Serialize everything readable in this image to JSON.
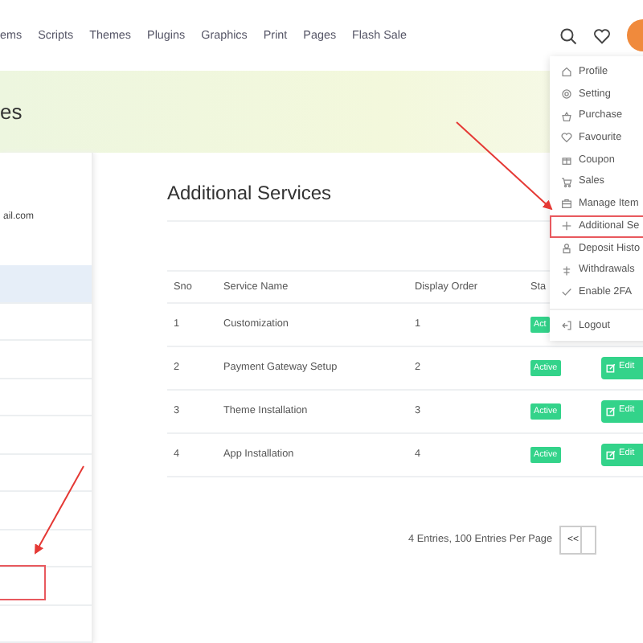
{
  "nav": {
    "items": [
      "ems",
      "Scripts",
      "Themes",
      "Plugins",
      "Graphics",
      "Print",
      "Pages",
      "Flash Sale"
    ]
  },
  "banner": {
    "title": "es"
  },
  "sidebar": {
    "email": "ail.com",
    "rows": [
      {
        "selected": true
      },
      {
        "selected": false
      },
      {
        "selected": false
      },
      {
        "selected": false
      },
      {
        "selected": false
      },
      {
        "selected": false
      },
      {
        "selected": false
      },
      {
        "selected": false
      },
      {
        "selected": false
      },
      {
        "selected": false
      }
    ]
  },
  "main": {
    "title": "Additional Services",
    "columns": [
      "Sno",
      "Service Name",
      "Display Order",
      "Sta"
    ],
    "rows": [
      {
        "sno": "1",
        "name": "Customization",
        "order": "1",
        "status": "Act",
        "action": null
      },
      {
        "sno": "2",
        "name": "Payment Gateway Setup",
        "order": "2",
        "status": "Active",
        "action": "Edit"
      },
      {
        "sno": "3",
        "name": "Theme Installation",
        "order": "3",
        "status": "Active",
        "action": "Edit"
      },
      {
        "sno": "4",
        "name": "App Installation",
        "order": "4",
        "status": "Active",
        "action": "Edit"
      }
    ],
    "footer": "4 Entries, 100 Entries Per Page",
    "pagination": [
      "<<"
    ]
  },
  "user_menu": {
    "items": [
      {
        "label": "Profile",
        "highlighted": false
      },
      {
        "label": "Setting",
        "highlighted": false
      },
      {
        "label": "Purchase",
        "highlighted": false
      },
      {
        "label": "Favourite",
        "highlighted": false
      },
      {
        "label": "Coupon",
        "highlighted": false
      },
      {
        "label": "Sales",
        "highlighted": false
      },
      {
        "label": "Manage Item",
        "highlighted": false
      },
      {
        "label": "Additional Se",
        "highlighted": true
      },
      {
        "label": "Deposit Histo",
        "highlighted": false
      },
      {
        "label": "Withdrawals",
        "highlighted": false
      },
      {
        "label": "Enable 2FA",
        "highlighted": false
      }
    ],
    "logout": "Logout"
  }
}
